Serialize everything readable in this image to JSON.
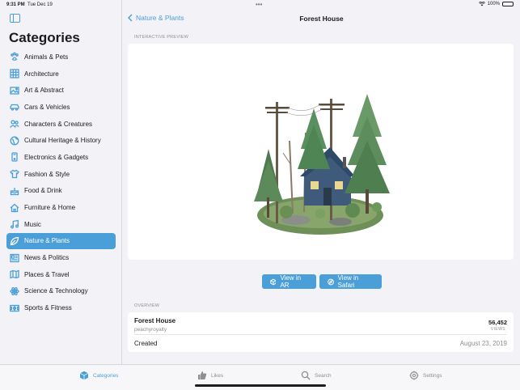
{
  "status_bar": {
    "time": "9:31 PM",
    "date": "Tue Dec 19",
    "battery": "100%",
    "dots": "•••"
  },
  "sidebar": {
    "title": "Categories",
    "items": [
      {
        "label": "Animals & Pets",
        "icon": "paw-icon"
      },
      {
        "label": "Architecture",
        "icon": "building-icon"
      },
      {
        "label": "Art & Abstract",
        "icon": "image-icon"
      },
      {
        "label": "Cars & Vehicles",
        "icon": "car-icon"
      },
      {
        "label": "Characters & Creatures",
        "icon": "people-icon"
      },
      {
        "label": "Cultural Heritage & History",
        "icon": "globe-icon"
      },
      {
        "label": "Electronics & Gadgets",
        "icon": "device-icon"
      },
      {
        "label": "Fashion & Style",
        "icon": "shirt-icon"
      },
      {
        "label": "Food & Drink",
        "icon": "cake-icon"
      },
      {
        "label": "Furniture & Home",
        "icon": "house-icon"
      },
      {
        "label": "Music",
        "icon": "music-note-icon"
      },
      {
        "label": "Nature & Plants",
        "icon": "leaf-icon",
        "selected": true
      },
      {
        "label": "News & Politics",
        "icon": "newspaper-icon"
      },
      {
        "label": "Places & Travel",
        "icon": "map-icon"
      },
      {
        "label": "Science & Technology",
        "icon": "atom-icon"
      },
      {
        "label": "Sports & Fitness",
        "icon": "sports-icon"
      }
    ]
  },
  "detail": {
    "back_label": "Nature & Plants",
    "title": "Forest House",
    "preview_label": "INTERACTIVE PREVIEW",
    "buttons": {
      "ar": "View in AR",
      "safari": "View in Safari"
    },
    "overview_label": "OVERVIEW",
    "overview": {
      "name": "Forest House",
      "author": "peachyroyalty",
      "views": "56,452",
      "views_label": "VIEWS",
      "created_label": "Created",
      "created_date": "August 23, 2019"
    }
  },
  "tabbar": {
    "tabs": [
      {
        "label": "Categories",
        "icon": "cube-icon",
        "active": true
      },
      {
        "label": "Likes",
        "icon": "thumbs-up-icon"
      },
      {
        "label": "Search",
        "icon": "search-icon"
      },
      {
        "label": "Settings",
        "icon": "gear-icon"
      }
    ]
  },
  "colors": {
    "accent": "#4a9fd8",
    "background": "#f2f2f7",
    "card": "#ffffff"
  }
}
